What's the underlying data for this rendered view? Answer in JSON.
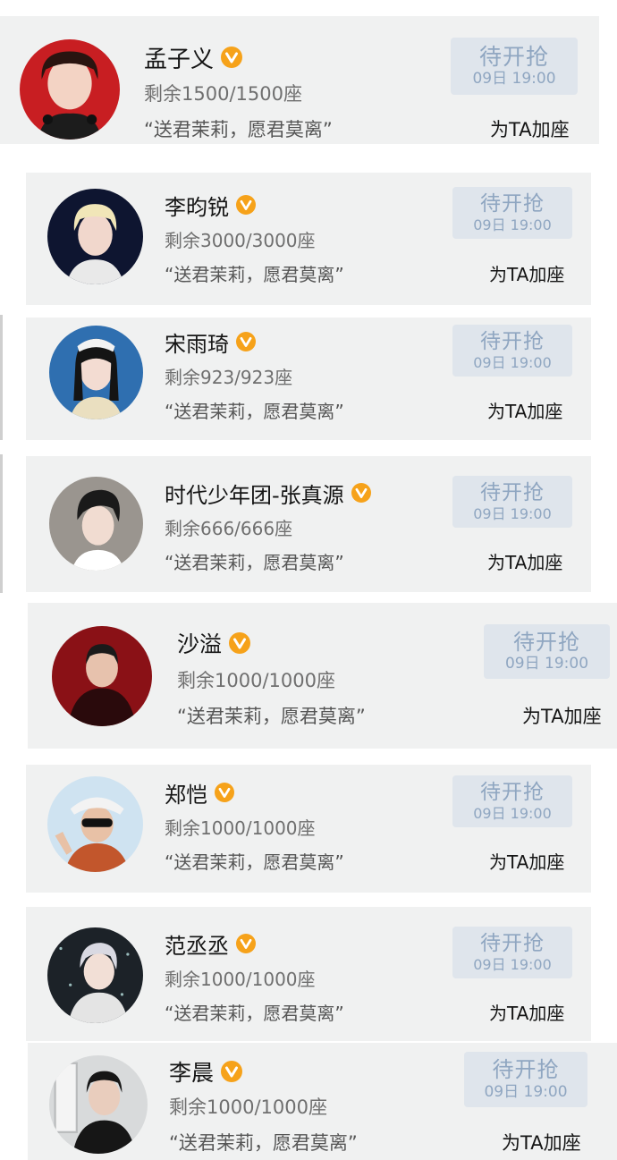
{
  "colors": {
    "card_bg": "#f0f1f1",
    "button_bg": "#dfe5ec",
    "button_text": "#8fa6c1",
    "badge": "#f6a21a",
    "name_text": "#151515",
    "meta_text": "#6f6f6f"
  },
  "cards": [
    {
      "name": "孟子义",
      "seats": "剩余1500/1500座",
      "slogan": "“送君茉莉，愿君莫离”",
      "button_label": "待开抢",
      "button_time": "09日 19:00",
      "add_seat": "为TA加座",
      "avatar_icon": "portrait-red-bg"
    },
    {
      "name": "李昀锐",
      "seats": "剩余3000/3000座",
      "slogan": "“送君茉莉，愿君莫离”",
      "button_label": "待开抢",
      "button_time": "09日 19:00",
      "add_seat": "为TA加座",
      "avatar_icon": "portrait-blond-hair"
    },
    {
      "name": "宋雨琦",
      "seats": "剩余923/923座",
      "slogan": "“送君茉莉，愿君莫离”",
      "button_label": "待开抢",
      "button_time": "09日 19:00",
      "add_seat": "为TA加座",
      "avatar_icon": "portrait-blue-bg"
    },
    {
      "name": "时代少年团-张真源",
      "seats": "剩余666/666座",
      "slogan": "“送君茉莉，愿君莫离”",
      "button_label": "待开抢",
      "button_time": "09日 19:00",
      "add_seat": "为TA加座",
      "avatar_icon": "portrait-grey-bg"
    },
    {
      "name": "沙溢",
      "seats": "剩余1000/1000座",
      "slogan": "“送君茉莉，愿君莫离”",
      "button_label": "待开抢",
      "button_time": "09日 19:00",
      "add_seat": "为TA加座",
      "avatar_icon": "portrait-dark-red-bg"
    },
    {
      "name": "郑恺",
      "seats": "剩余1000/1000座",
      "slogan": "“送君茉莉，愿君莫离”",
      "button_label": "待开抢",
      "button_time": "09日 19:00",
      "add_seat": "为TA加座",
      "avatar_icon": "portrait-sunglasses-hat"
    },
    {
      "name": "范丞丞",
      "seats": "剩余1000/1000座",
      "slogan": "“送君茉莉，愿君莫离”",
      "button_label": "待开抢",
      "button_time": "09日 19:00",
      "add_seat": "为TA加座",
      "avatar_icon": "portrait-starry-bg"
    },
    {
      "name": "李晨",
      "seats": "剩余1000/1000座",
      "slogan": "“送君茉莉，愿君莫离”",
      "button_label": "待开抢",
      "button_time": "09日 19:00",
      "add_seat": "为TA加座",
      "avatar_icon": "portrait-window-bg"
    }
  ]
}
